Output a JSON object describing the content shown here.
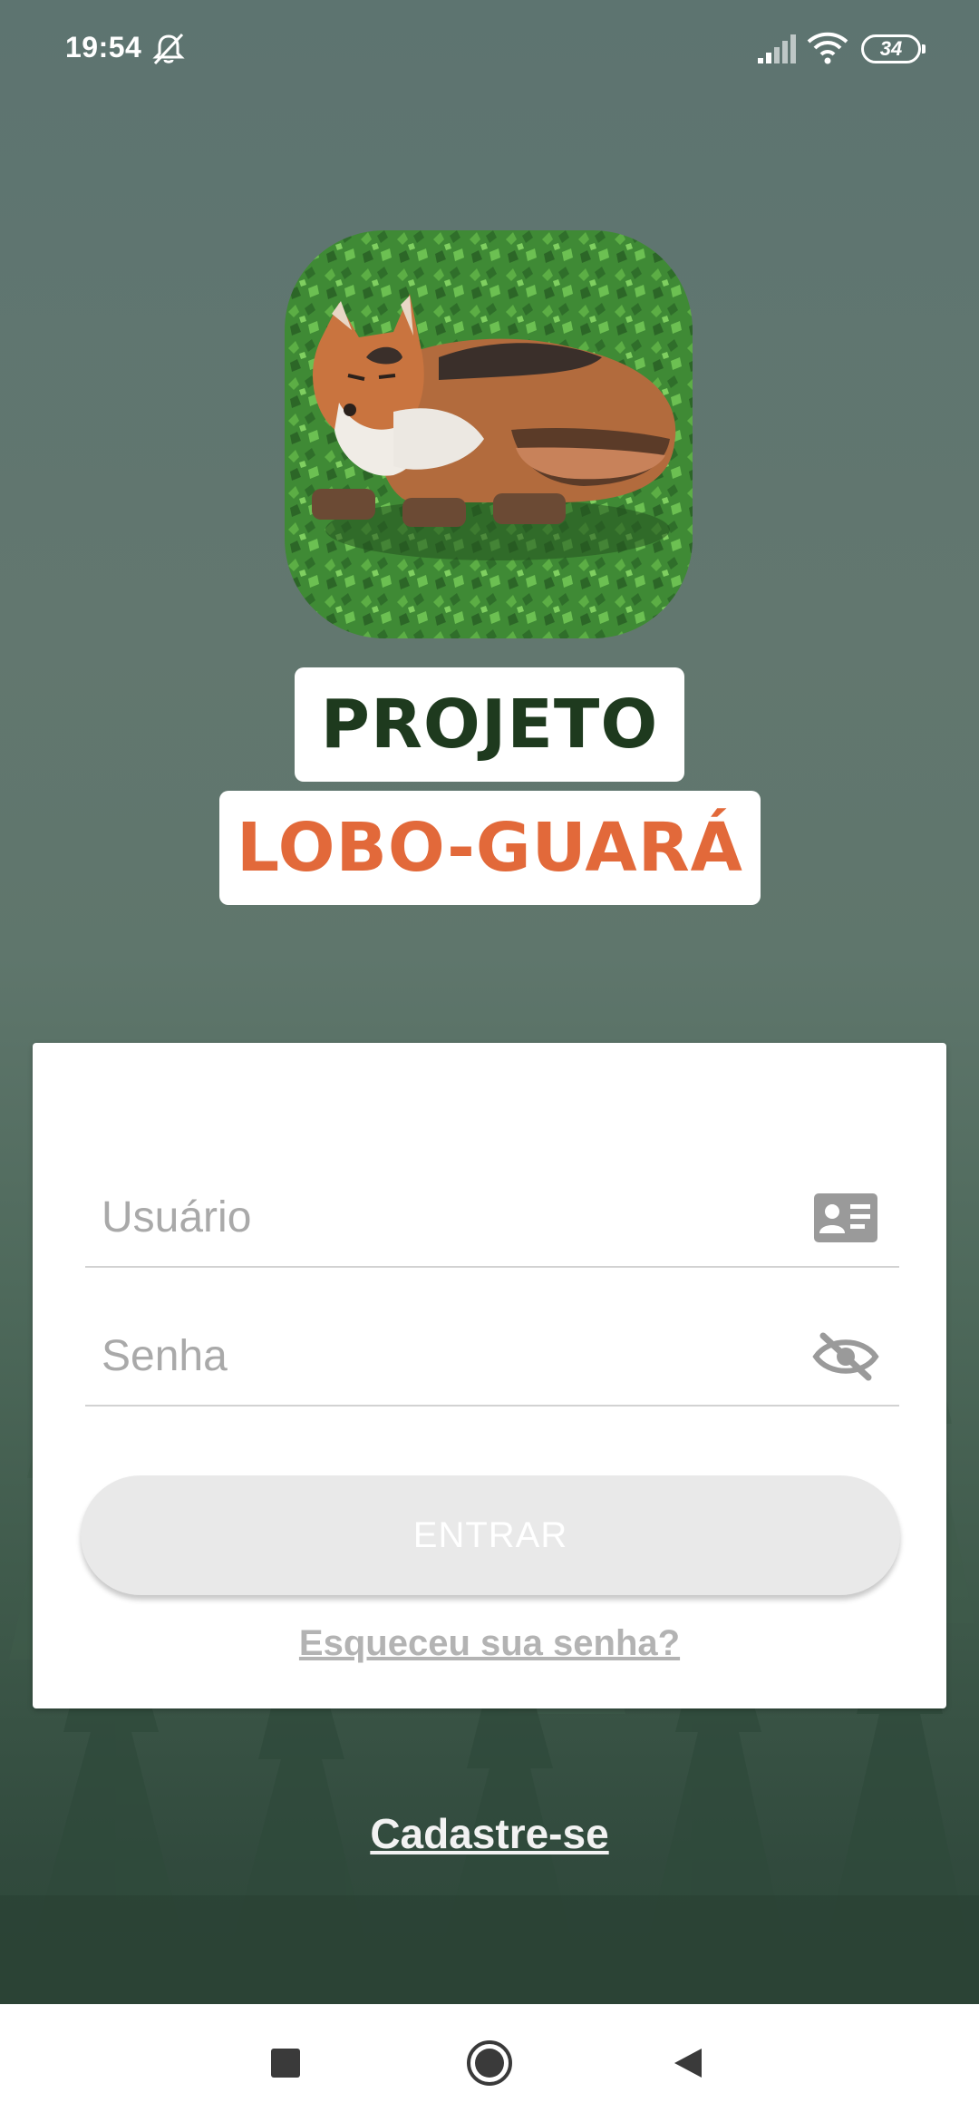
{
  "status_bar": {
    "time": "19:54",
    "battery": "34",
    "icons": [
      "bell-off-icon",
      "signal-icon",
      "wifi-icon",
      "battery-icon"
    ]
  },
  "logo": {
    "icon": "sleeping-fox-logo"
  },
  "title": {
    "line1": "PROJETO",
    "line2": "LOBO-GUARÁ"
  },
  "login": {
    "username_placeholder": "Usuário",
    "username_value": "",
    "username_icon": "id-card-icon",
    "password_placeholder": "Senha",
    "password_value": "",
    "password_icon": "eye-off-icon",
    "submit_label": "ENTRAR",
    "forgot_label": "Esqueceu sua senha?"
  },
  "register_label": "Cadastre-se",
  "nav": {
    "icons": [
      "recent-apps-icon",
      "home-icon",
      "back-icon"
    ]
  },
  "colors": {
    "title_dark": "#1e3a1e",
    "title_orange": "#e2693a",
    "button_bg": "#e9e9e9",
    "link_gray": "#b3b3b3"
  }
}
